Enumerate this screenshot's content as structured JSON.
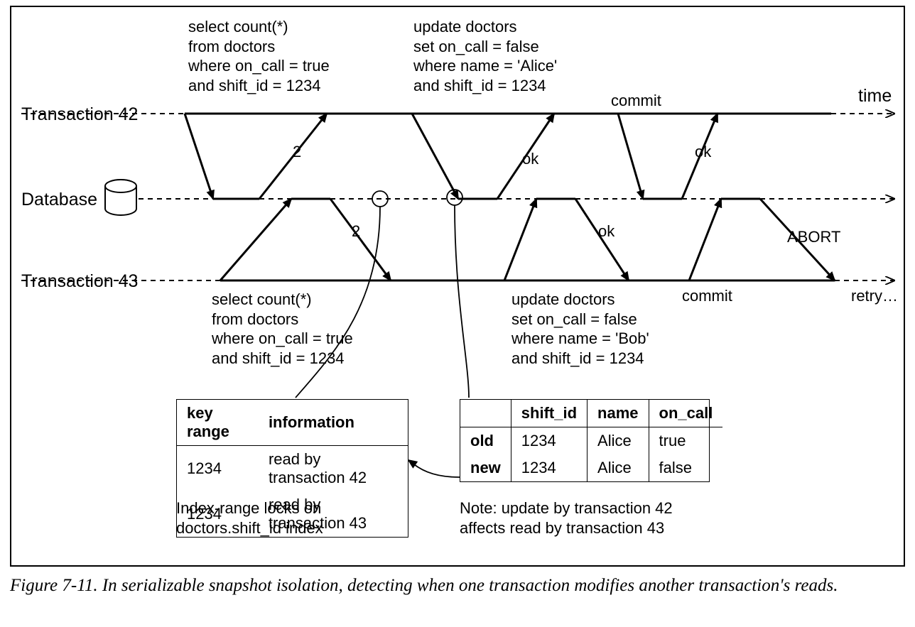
{
  "labels": {
    "time": "time",
    "t42": "Transaction 42",
    "db": "Database",
    "t43": "Transaction 43",
    "commit_a": "commit",
    "commit_b": "commit",
    "retry": "retry…",
    "abort": "ABORT"
  },
  "sql": {
    "t42_select": "select count(*)\nfrom doctors\nwhere on_call = true\nand shift_id = 1234",
    "t42_update": "update doctors\nset on_call = false\nwhere name = 'Alice'\nand shift_id = 1234",
    "t43_select": "select count(*)\nfrom doctors\nwhere on_call = true\nand shift_id = 1234",
    "t43_update": "update doctors\nset on_call = false\nwhere name = 'Bob'\nand shift_id = 1234"
  },
  "arrow_labels": {
    "r42": "2",
    "r43": "2",
    "ok42u": "ok",
    "ok42c": "ok",
    "ok43u": "ok"
  },
  "tables": {
    "locks": {
      "headers": [
        "key range",
        "information"
      ],
      "rows": [
        [
          "1234",
          "read by transaction 42"
        ],
        [
          "1234",
          "read by transaction 43"
        ]
      ],
      "caption": "Index-range locks on\ndoctors.shift_id index"
    },
    "versions": {
      "headers": [
        "",
        "shift_id",
        "name",
        "on_call"
      ],
      "rows": [
        [
          "old",
          "1234",
          "Alice",
          "true"
        ],
        [
          "new",
          "1234",
          "Alice",
          "false"
        ]
      ],
      "caption": "Note: update by transaction 42\naffects read by transaction 43"
    }
  },
  "figure_caption": "Figure 7-11. In serializable snapshot isolation, detecting when one transaction modifies another transaction's reads."
}
